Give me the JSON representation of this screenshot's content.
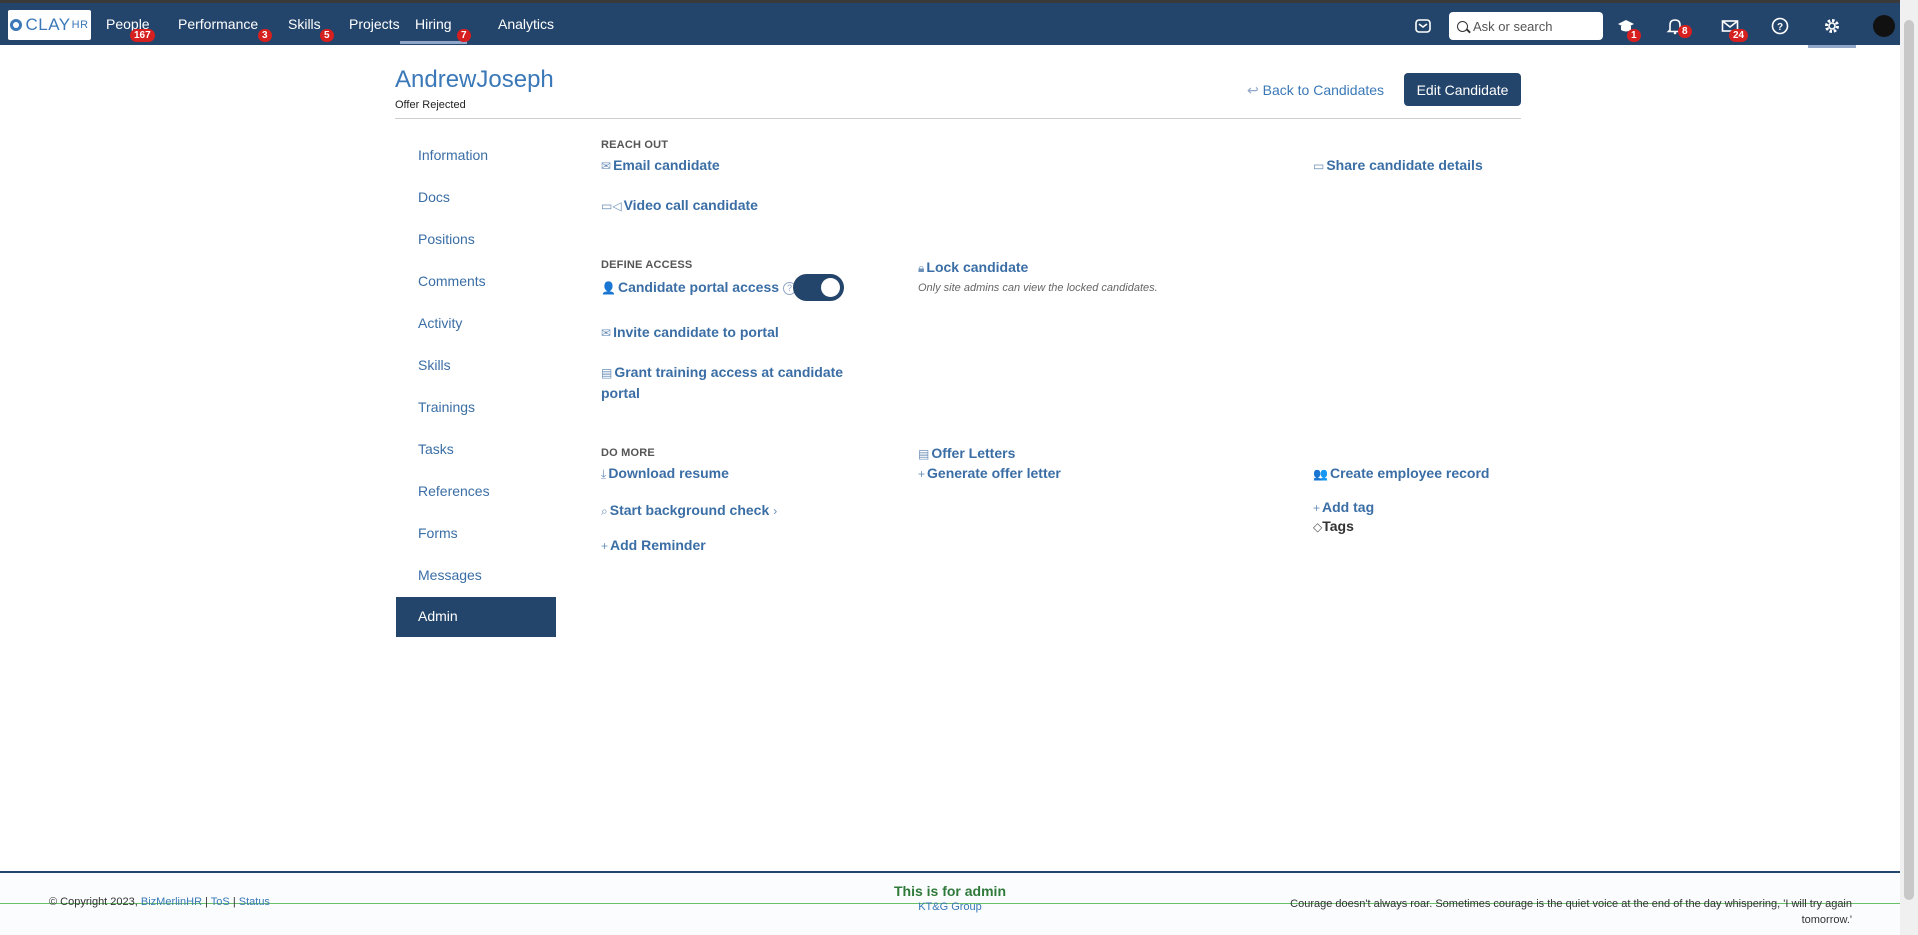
{
  "nav": {
    "logo": "CLAY",
    "logo_suffix": "HR",
    "items": [
      {
        "label": "People",
        "badge": "167"
      },
      {
        "label": "Performance",
        "badge": "3"
      },
      {
        "label": "Skills",
        "badge": "5"
      },
      {
        "label": "Projects",
        "badge": ""
      },
      {
        "label": "Hiring",
        "badge": "7"
      },
      {
        "label": "Analytics",
        "badge": ""
      }
    ],
    "search_placeholder": "Ask or search",
    "courses_badge": "1",
    "notifications_badge": "8",
    "messages_badge": "24",
    "icons": [
      "inbox-icon",
      "search-icon",
      "courses-icon",
      "bell-icon",
      "mail-icon",
      "help-icon",
      "gear-icon",
      "avatar"
    ]
  },
  "candidate": {
    "name": "AndrewJoseph",
    "status": "Offer Rejected",
    "back_label": "Back to Candidates",
    "edit_label": "Edit Candidate"
  },
  "sidebar": {
    "items": [
      "Information",
      "Docs",
      "Positions",
      "Comments",
      "Activity",
      "Skills",
      "Trainings",
      "Tasks",
      "References",
      "Forms",
      "Messages"
    ],
    "active": "Admin"
  },
  "admin": {
    "reach_out": {
      "title": "REACH OUT",
      "email": "Email candidate",
      "video": "Video call candidate",
      "share": "Share candidate details"
    },
    "define_access": {
      "title": "DEFINE ACCESS",
      "portal": "Candidate portal access",
      "portal_enabled": true,
      "invite": "Invite candidate to portal",
      "training_line1": "Grant training access at candidate",
      "training_line2": "portal",
      "lock": "Lock candidate",
      "lock_note": "Only site admins can view the locked candidates."
    },
    "do_more": {
      "title": "DO MORE",
      "download": "Download resume",
      "background": "Start background check",
      "reminder": "Add Reminder",
      "offer_letters": "Offer Letters",
      "generate": "Generate offer letter",
      "employee": "Create employee record",
      "add_tag": "Add tag",
      "tags": "Tags"
    }
  },
  "footer": {
    "copyright": "© Copyright 2023,",
    "company": "BizMerlinHR",
    "tos": "ToS",
    "status": "Status",
    "admin_note": "This is for admin",
    "org": "KT&G Group",
    "quote_line1": "Courage doesn't always roar. Sometimes courage is the quiet voice at the end of the day whispering, 'I will try again",
    "quote_line2": "tomorrow.'"
  },
  "colors": {
    "nav_bg": "#24456b",
    "link": "#3a6ea5",
    "badge": "#d61f1f",
    "admin_green": "#2f7a3a"
  }
}
